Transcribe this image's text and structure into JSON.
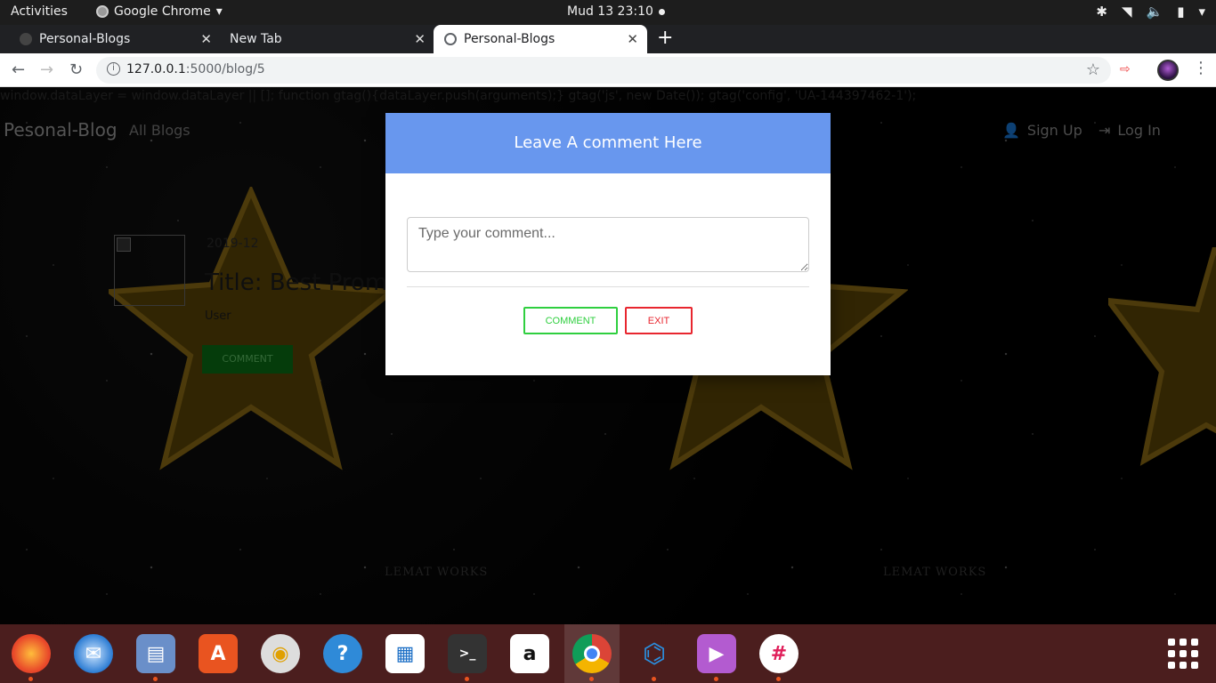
{
  "topbar": {
    "activities": "Activities",
    "app_name": "Google Chrome",
    "clock": "Mud 13  23:10"
  },
  "tabs": [
    {
      "label": "Personal-Blogs",
      "active": false
    },
    {
      "label": "New Tab",
      "active": false
    },
    {
      "label": "Personal-Blogs",
      "active": true
    }
  ],
  "address_bar": {
    "url_host": "127.0.0.1",
    "url_rest": ":5000/blog/5"
  },
  "site": {
    "script_leak": "window.dataLayer = window.dataLayer || []; function gtag(){dataLayer.push(arguments);} gtag('js', new Date()); gtag('config', 'UA-144397462-1');",
    "brand": "Pesonal-Blog",
    "nav_all_blogs": "All Blogs",
    "nav_sign_up": "Sign Up",
    "nav_log_in": "Log In",
    "post_date": "2019-12",
    "post_title": "Title: Best Prome",
    "post_user": "User",
    "comment_button": "COMMENT",
    "watermark": "LEMAT WORKS"
  },
  "modal": {
    "title": "Leave A comment Here",
    "textarea_placeholder": "Type your comment...",
    "comment_button": "COMMENT",
    "exit_button": "EXIT"
  },
  "dock": [
    {
      "name": "firefox",
      "running": true
    },
    {
      "name": "thunderbird",
      "running": false
    },
    {
      "name": "files",
      "running": true
    },
    {
      "name": "software-center",
      "running": false
    },
    {
      "name": "rhythmbox",
      "running": false
    },
    {
      "name": "help",
      "running": false
    },
    {
      "name": "libreoffice-writer",
      "running": false
    },
    {
      "name": "terminal",
      "running": true
    },
    {
      "name": "amazon",
      "running": false
    },
    {
      "name": "chrome",
      "running": true
    },
    {
      "name": "vscode",
      "running": true
    },
    {
      "name": "video-player",
      "running": true
    },
    {
      "name": "slack",
      "running": true
    }
  ],
  "colors": {
    "modal_header": "#6897ee",
    "comment_green": "#2fcf3f",
    "exit_red": "#e8262f",
    "dock_bg": "#4b1e1e"
  }
}
